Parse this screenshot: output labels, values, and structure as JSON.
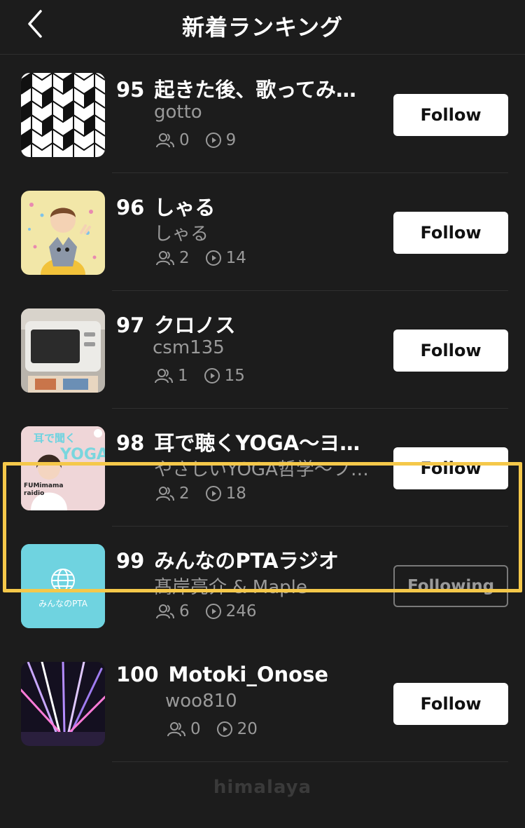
{
  "header": {
    "title": "新着ランキング"
  },
  "items": [
    {
      "rank": "95",
      "title": "起きた後、歌ってみ…",
      "author": "gotto",
      "followers": "0",
      "plays": "9",
      "button": "Follow"
    },
    {
      "rank": "96",
      "title": "しゃる",
      "author": "しゃる",
      "followers": "2",
      "plays": "14",
      "button": "Follow"
    },
    {
      "rank": "97",
      "title": "クロノス",
      "author": "csm135",
      "followers": "1",
      "plays": "15",
      "button": "Follow"
    },
    {
      "rank": "98",
      "title": "耳で聴くYOGA〜ヨ…",
      "author": "やさしいYOGA哲学〜フ…",
      "followers": "2",
      "plays": "18",
      "button": "Follow",
      "thumb_text": {
        "top": "耳で聞く",
        "main": "YOGA",
        "sub": "FUMimama raidio"
      }
    },
    {
      "rank": "99",
      "title": "みんなのPTAラジオ",
      "author": "髙岸亮介 & Maple",
      "followers": "6",
      "plays": "246",
      "button": "Following",
      "thumb_text": {
        "label": "みんなのPTA"
      }
    },
    {
      "rank": "100",
      "title": "Motoki_Onose",
      "author": "woo810",
      "followers": "0",
      "plays": "20",
      "button": "Follow"
    }
  ],
  "footer": {
    "brand": "himalaya"
  },
  "colors": {
    "background": "#1c1c1c",
    "highlight": "#f5c84a",
    "pta_thumb": "#6fd3e0"
  }
}
